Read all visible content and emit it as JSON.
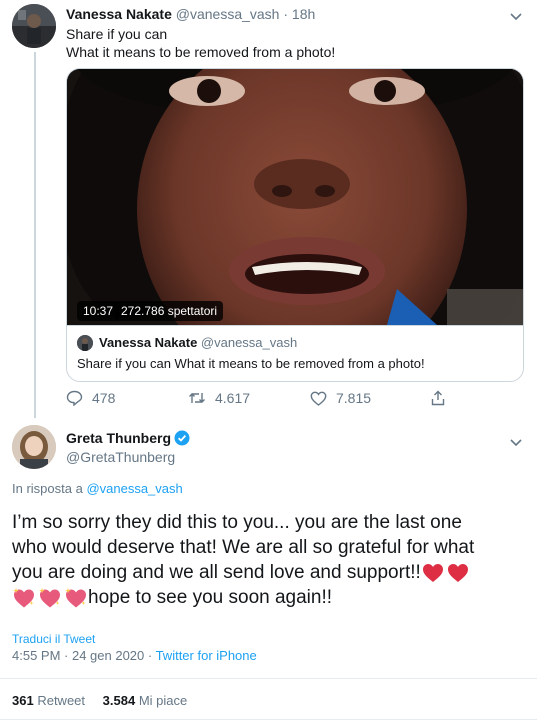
{
  "parent_tweet": {
    "author_name": "Vanessa Nakate",
    "handle": "@vanessa_vash",
    "time": "· 18h",
    "text_line1": "Share if you can",
    "text_line2": "What it means to be removed from a photo!",
    "video": {
      "duration": "10:37",
      "viewers": "272.786 spettatori"
    },
    "quoted": {
      "author_name": "Vanessa Nakate",
      "handle": "@vanessa_vash",
      "text": "Share if you can What it means to be removed from a photo!"
    },
    "actions": {
      "replies": "478",
      "retweets": "4.617",
      "likes": "7.815"
    }
  },
  "main_tweet": {
    "author_name": "Greta Thunberg",
    "handle": "@GretaThunberg",
    "reply_prefix": "In risposta a ",
    "reply_to": "@vanessa_vash",
    "text_line1": "I’m so sorry they did this to you... you are the last one",
    "text_line2": "who would deserve that! We are all so grateful for what",
    "text_line3": "you are doing and we all send love and support!!",
    "text_line4": "hope to see you soon again!!",
    "translate": "Traduci il Tweet",
    "datetime": "4:55 PM · 24 gen 2020 · ",
    "source": "Twitter for iPhone",
    "retweet_count": "361",
    "retweet_label": "Retweet",
    "like_count": "3.584",
    "like_label": "Mi piace"
  },
  "colors": {
    "link_blue": "#1da1f2",
    "muted_gray": "#657786",
    "border": "#e6ecf0",
    "heart_red": "#dd2e44",
    "sparkle_heart": "#f4abba"
  },
  "icons": [
    "chevron-down-icon",
    "reply-icon",
    "retweet-icon",
    "like-icon",
    "share-icon",
    "verified-badge-icon",
    "red-heart-icon",
    "sparkling-heart-icon"
  ]
}
